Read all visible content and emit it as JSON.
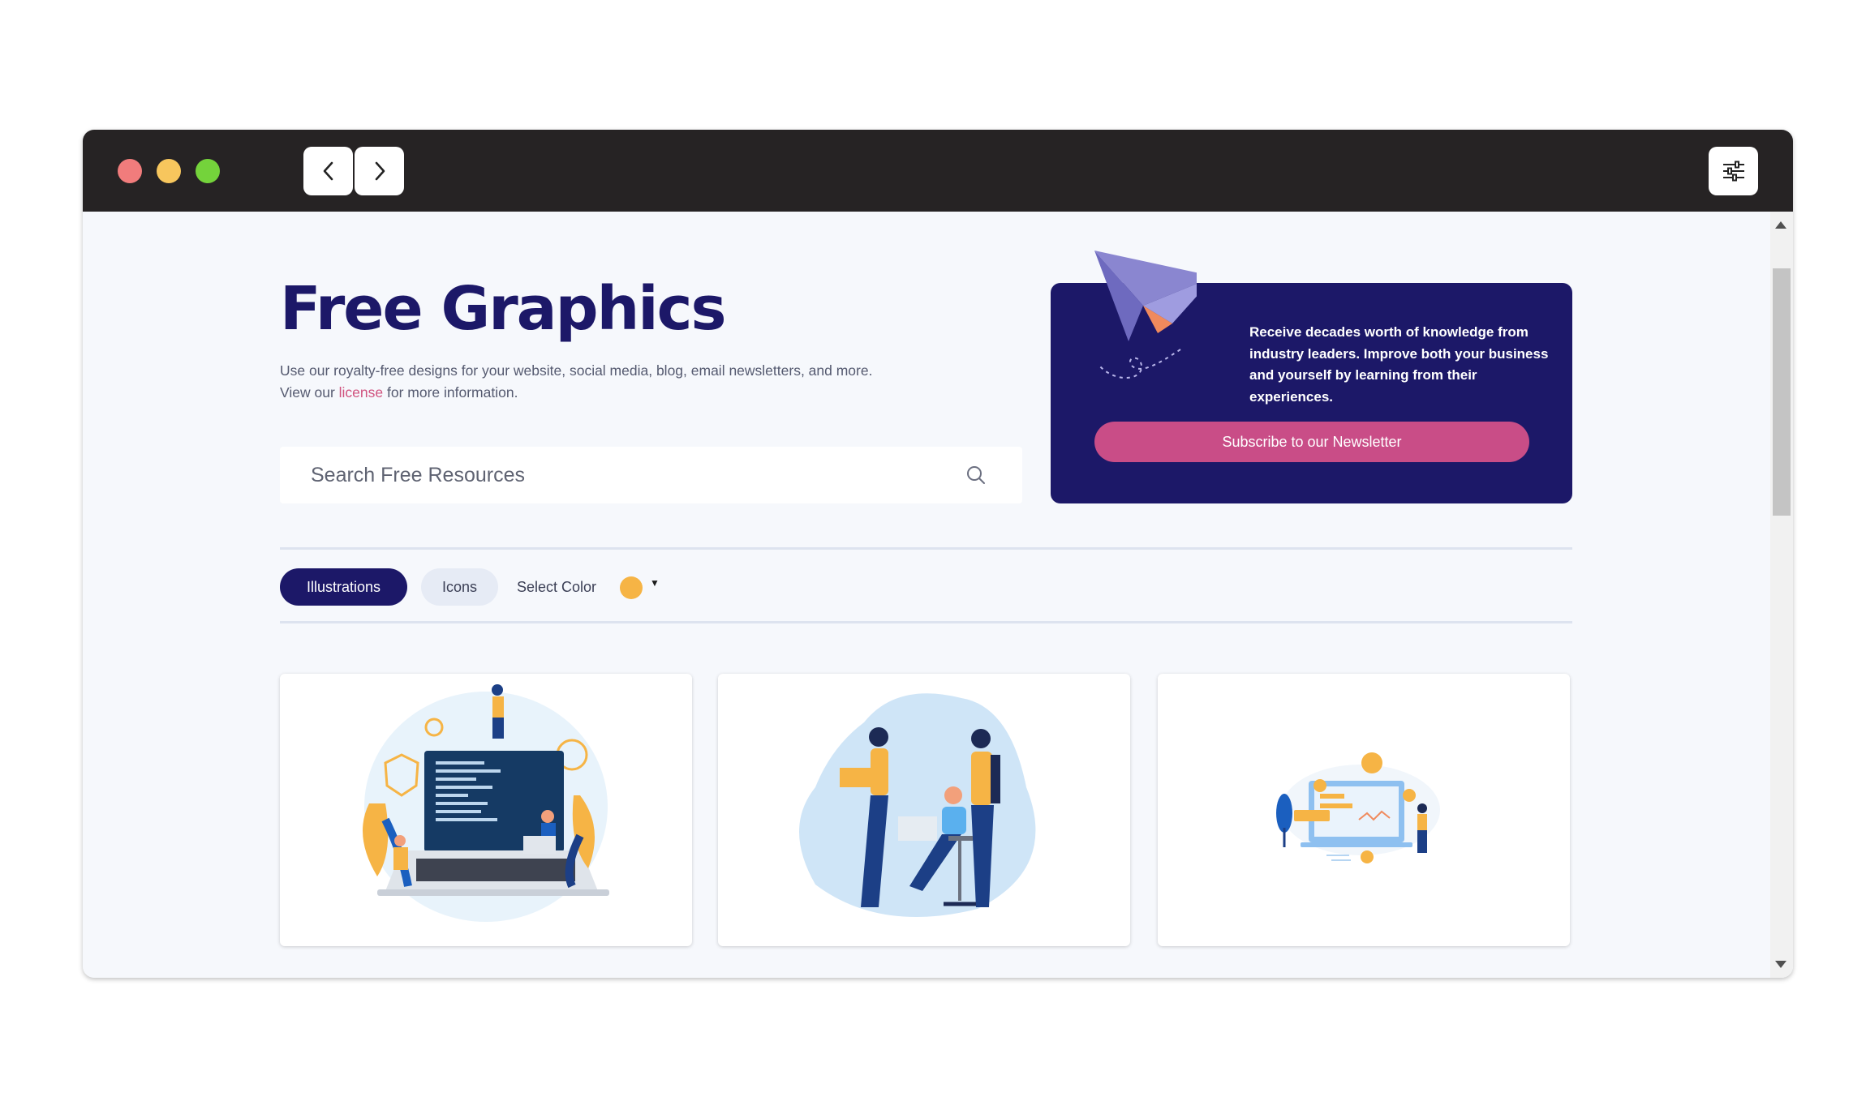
{
  "hero": {
    "title": "Free Graphics",
    "desc_before": "Use our royalty-free designs for your website, social media, blog, email newsletters, and more. View our ",
    "desc_link": "license",
    "desc_after": " for more information."
  },
  "search": {
    "placeholder": "Search Free Resources",
    "icon": "search-icon"
  },
  "promo": {
    "text": "Receive decades worth of knowledge from industry leaders. Improve both your business and yourself by learning from their experiences.",
    "button_label": "Subscribe to our Newsletter",
    "icon": "paper-plane-icon"
  },
  "filters": {
    "tabs": [
      {
        "label": "Illustrations",
        "active": true
      },
      {
        "label": "Icons",
        "active": false
      }
    ],
    "color_label": "Select Color",
    "selected_color": "#f6b445"
  },
  "cards": [
    {
      "subject": "people working on a large laptop with code"
    },
    {
      "subject": "team of three people with laptops"
    },
    {
      "subject": "person presenting a dashboard screen"
    }
  ],
  "colors": {
    "brand_navy": "#1c1868",
    "accent_pink": "#c94d87",
    "titlebar": "#262324"
  }
}
